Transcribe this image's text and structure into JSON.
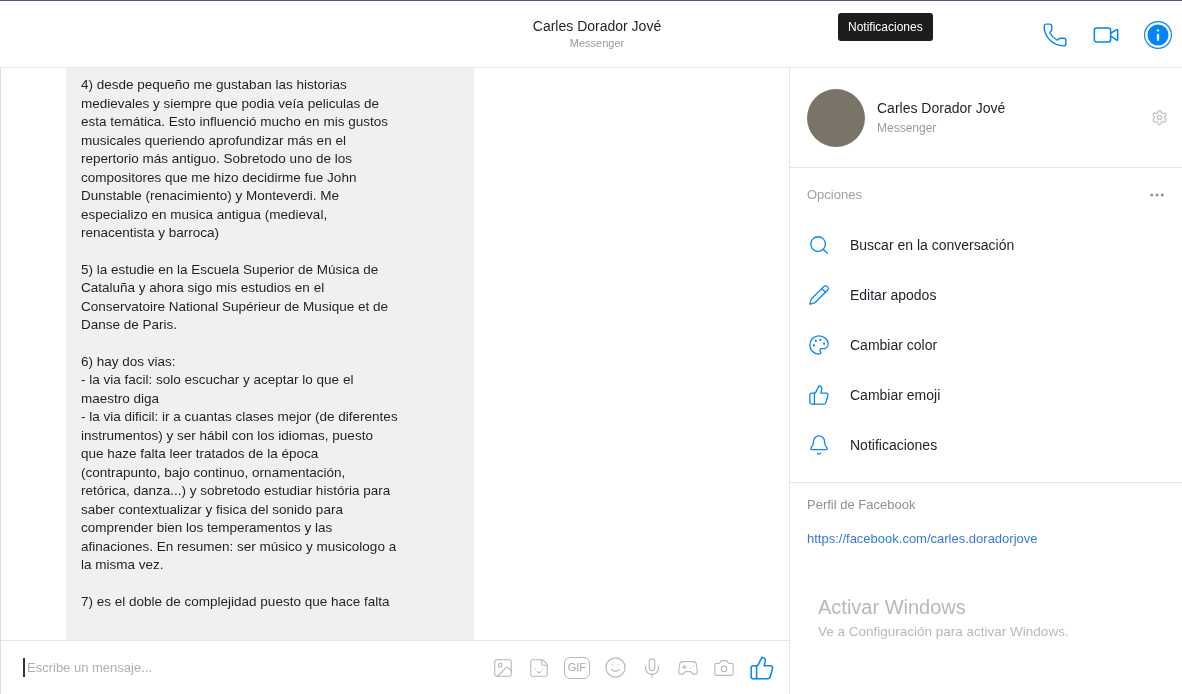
{
  "header": {
    "title": "Carles Dorador Jové",
    "subtitle": "Messenger"
  },
  "tooltip": {
    "text": "Notificaciones"
  },
  "message": {
    "paragraphs": [
      [
        "4) desde pequeño me gustaban las historias",
        "medievales y siempre que podia veía peliculas de",
        "esta temática. Esto influenció mucho en mis gustos",
        "musicales queriendo aprofundizar más en el",
        "repertorio más antiguo. Sobretodo uno de los",
        "compositores que me hizo decidirme fue John",
        "Dunstable (renacimiento) y Monteverdi. Me",
        "especializo en musica antigua (medieval,",
        "renacentista y barroca)"
      ],
      [
        "5) la estudie en la Escuela Superior de Música de",
        "Cataluña y ahora sigo mis estudios en el",
        "Conservatoire National Supérieur de Musique et de",
        "Danse de Paris."
      ],
      [
        "6) hay dos vias:",
        "- la via facil: solo escuchar y aceptar lo que el",
        "maestro diga",
        "- la via dificil: ir a cuantas clases mejor (de diferentes",
        "instrumentos) y ser hábil con los idiomas, puesto",
        "que haze falta leer tratados de la época",
        "(contrapunto, bajo continuo, ornamentación,",
        "retórica, danza...) y sobretodo estudiar história para",
        "saber contextualizar y fisica del sonido para",
        "comprender bien los temperamentos y las",
        "afinaciones. En resumen: ser músico y musicologo a",
        "la misma vez."
      ],
      [
        "7) es el doble de complejidad puesto que hace falta"
      ]
    ]
  },
  "composer": {
    "placeholder": "Escribe un mensaje...",
    "gif_label": "GIF"
  },
  "panel": {
    "name": "Carles Dorador Jové",
    "subtitle": "Messenger",
    "options_label": "Opciones",
    "options": [
      {
        "kind": "search",
        "label": "Buscar en la conversación"
      },
      {
        "kind": "edit",
        "label": "Editar apodos"
      },
      {
        "kind": "color",
        "label": "Cambiar color"
      },
      {
        "kind": "emoji",
        "label": "Cambiar emoji"
      },
      {
        "kind": "notifications",
        "label": "Notificaciones"
      }
    ],
    "profile_label": "Perfil de Facebook",
    "profile_link": "https://facebook.com/carles.doradorjove"
  },
  "os_notice": {
    "title": "Activar Windows",
    "text": "Ve a Configuración para activar Windows."
  }
}
